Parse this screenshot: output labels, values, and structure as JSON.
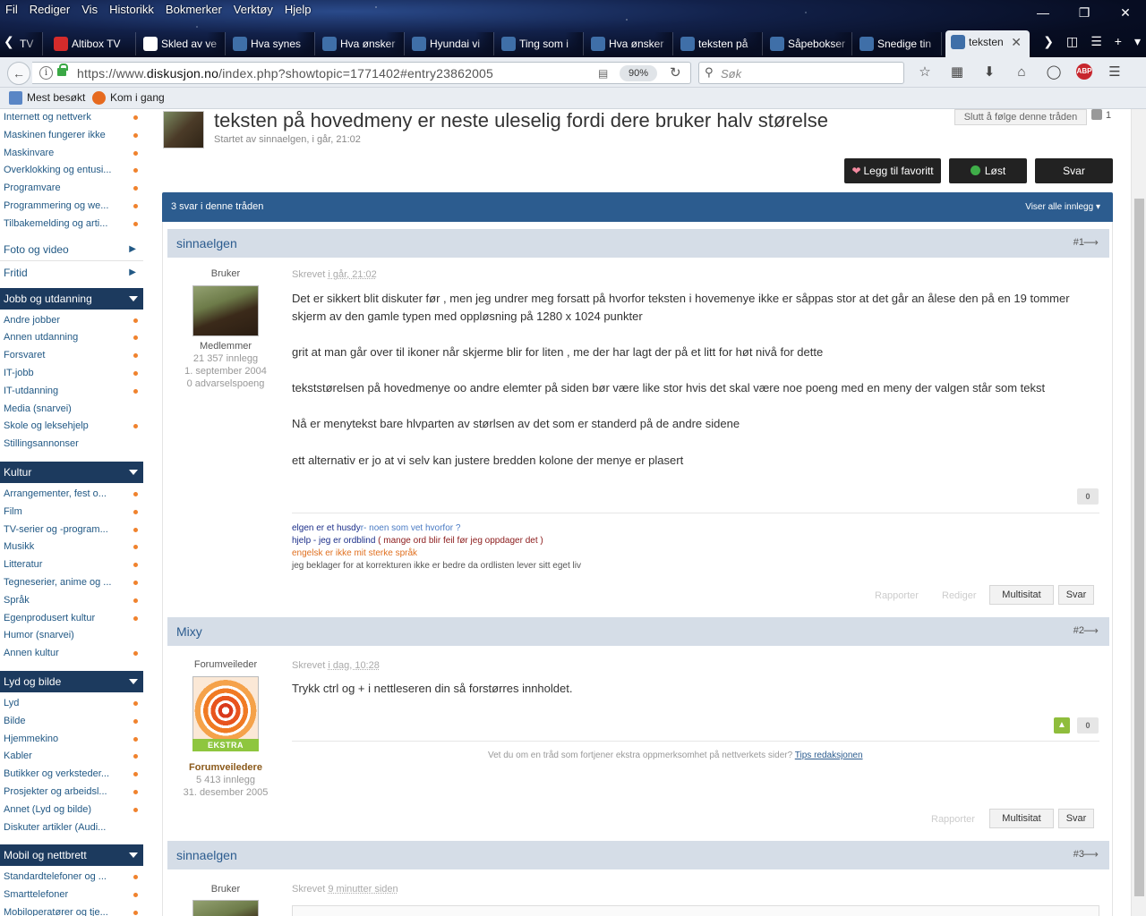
{
  "browser": {
    "menu": [
      "Fil",
      "Rediger",
      "Vis",
      "Historikk",
      "Bokmerker",
      "Verktøy",
      "Hjelp"
    ],
    "tabs": [
      {
        "label": "TV",
        "color": "#6b6b6b"
      },
      {
        "label": "Altibox TV",
        "color": "#d52b2b"
      },
      {
        "label": "Skled av ve",
        "color": "#ffffff"
      },
      {
        "label": "Hva synes",
        "color": "#3f6fa8"
      },
      {
        "label": "Hva ønsker",
        "color": "#3f6fa8"
      },
      {
        "label": "Hyundai vi",
        "color": "#3f6fa8"
      },
      {
        "label": "Ting som i",
        "color": "#3f6fa8"
      },
      {
        "label": "Hva ønsker",
        "color": "#3f6fa8"
      },
      {
        "label": "teksten på",
        "color": "#3f6fa8"
      },
      {
        "label": "Såpebokser",
        "color": "#3f6fa8"
      },
      {
        "label": "Snedige tin",
        "color": "#3f6fa8"
      }
    ],
    "active_tab": "teksten",
    "url_prefix": "https://www.",
    "url_domain": "diskusjon.no",
    "url_rest": "/index.php?showtopic=1771402#entry23862005",
    "zoom": "90%",
    "search_placeholder": "Søk",
    "bookmarks": [
      "Mest besøkt",
      "Kom i gang"
    ]
  },
  "sidebar": {
    "top_items": [
      {
        "label": "Internett og nettverk",
        "dot": true
      },
      {
        "label": "Maskinen fungerer ikke",
        "dot": true
      },
      {
        "label": "Maskinvare",
        "dot": true
      },
      {
        "label": "Overklokking og entusi...",
        "dot": true
      },
      {
        "label": "Programvare",
        "dot": true
      },
      {
        "label": "Programmering og we...",
        "dot": true
      },
      {
        "label": "Tilbakemelding og arti...",
        "dot": true
      }
    ],
    "plain": [
      "Foto og video",
      "Fritid"
    ],
    "sections": [
      {
        "title": "Jobb og utdanning",
        "items": [
          {
            "label": "Andre jobber",
            "dot": true
          },
          {
            "label": "Annen utdanning",
            "dot": true
          },
          {
            "label": "Forsvaret",
            "dot": true
          },
          {
            "label": "IT-jobb",
            "dot": true
          },
          {
            "label": "IT-utdanning",
            "dot": true
          },
          {
            "label": "Media (snarvei)",
            "dot": false
          },
          {
            "label": "Skole og leksehjelp",
            "dot": true
          },
          {
            "label": "Stillingsannonser",
            "dot": false
          }
        ]
      },
      {
        "title": "Kultur",
        "items": [
          {
            "label": "Arrangementer, fest o...",
            "dot": true
          },
          {
            "label": "Film",
            "dot": true
          },
          {
            "label": "TV-serier og -program...",
            "dot": true
          },
          {
            "label": "Musikk",
            "dot": true
          },
          {
            "label": "Litteratur",
            "dot": true
          },
          {
            "label": "Tegneserier, anime og ...",
            "dot": true
          },
          {
            "label": "Språk",
            "dot": true
          },
          {
            "label": "Egenprodusert kultur",
            "dot": true
          },
          {
            "label": "Humor (snarvei)",
            "dot": false
          },
          {
            "label": "Annen kultur",
            "dot": true
          }
        ]
      },
      {
        "title": "Lyd og bilde",
        "items": [
          {
            "label": "Lyd",
            "dot": true
          },
          {
            "label": "Bilde",
            "dot": true
          },
          {
            "label": "Hjemmekino",
            "dot": true
          },
          {
            "label": "Kabler",
            "dot": true
          },
          {
            "label": "Butikker og verksteder...",
            "dot": true
          },
          {
            "label": "Prosjekter og arbeidsl...",
            "dot": true
          },
          {
            "label": "Annet (Lyd og bilde)",
            "dot": true
          },
          {
            "label": "Diskuter artikler (Audi...",
            "dot": false
          }
        ]
      },
      {
        "title": "Mobil og nettbrett",
        "items": [
          {
            "label": "Standardtelefoner og ...",
            "dot": true
          },
          {
            "label": "Smarttelefoner",
            "dot": true
          },
          {
            "label": "Mobiloperatører og tje...",
            "dot": true
          }
        ]
      }
    ]
  },
  "topic": {
    "title": "teksten på hovedmeny er neste uleselig fordi dere bruker halv størelse",
    "subtitle": "Startet av sinnaelgen, i går, 21:02",
    "follow_label": "Slutt å følge denne tråden",
    "follow_count": "1",
    "fav_label": "Legg til favoritt",
    "solved_label": "Løst",
    "reply_label": "Svar",
    "replies_text": "3 svar i denne tråden",
    "show_all": "Viser alle innlegg"
  },
  "posts": [
    {
      "author": "sinnaelgen",
      "num": "#1",
      "role": "Bruker",
      "group": "Medlemmer",
      "stats": [
        "21 357 innlegg",
        "1. september 2004",
        "0 advarselspoeng"
      ],
      "written_prefix": "Skrevet ",
      "written_time": "i går, 21:02",
      "paragraphs": [
        "Det er sikkert blit diskuter før , men jeg undrer meg forsatt på hvorfor teksten i hovemenye ikke er såppas stor at det går an ålese den på en 19 tommer skjerm av den gamle typen med oppløsning på 1280 x 1024 punkter",
        "grit at man går over til ikoner når skjerme blir for liten , me der har lagt der på et litt for høt nivå for dette",
        "tekststørelsen på hovedmenye oo andre elemter på siden bør være like stor hvis det skal være noe poeng med en meny  der valgen står som tekst",
        "Nå er menytekst bare hlvparten av størlsen av det som er standerd på de andre sidene",
        "ett alternativ er jo at vi selv kan justere bredden  kolone der menye er plasert"
      ],
      "rep": "0",
      "sig": [
        {
          "dark": "elgen er et husdy",
          "light": "r- noen som vet hvorfor ?"
        },
        {
          "dark": "hjelp - jeg er ordblind",
          "light": " ( mange ord blir feil før jeg oppdager det )"
        },
        {
          "orange": "engelsk er ikke mit sterke språk"
        },
        {
          "gray": "jeg beklager for at korrekturen ikke er bedre da ordlisten lever sitt eget liv"
        }
      ],
      "links": [
        "Rapporter",
        "Rediger"
      ],
      "buttons": [
        "Multisitat",
        "Svar"
      ]
    },
    {
      "author": "Mixy",
      "num": "#2",
      "role": "Forumveileder",
      "badge": "EKSTRA",
      "group": "Forumveiledere",
      "stats": [
        "5 413 innlegg",
        "31. desember 2005"
      ],
      "written_prefix": "Skrevet ",
      "written_time": "i dag, 10:28",
      "paragraphs": [
        "Trykk ctrl og + i nettleseren din så forstørres innholdet."
      ],
      "rep": "0",
      "notice": "Vet du om en tråd som fortjener ekstra oppmerksomhet på nettverkets sider? ",
      "notice_link": "Tips redaksjonen",
      "links": [
        "Rapporter"
      ],
      "buttons": [
        "Multisitat",
        "Svar"
      ]
    },
    {
      "author": "sinnaelgen",
      "num": "#3",
      "role": "Bruker",
      "written_prefix": "Skrevet ",
      "written_time": "9 minutter siden"
    }
  ]
}
